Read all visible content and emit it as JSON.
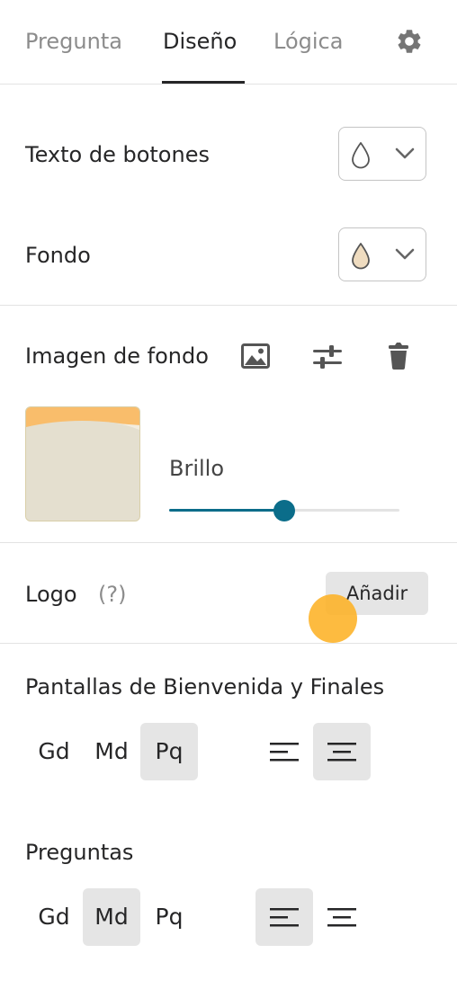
{
  "tabs": [
    {
      "label": "Pregunta",
      "active": false
    },
    {
      "label": "Diseño",
      "active": true
    },
    {
      "label": "Lógica",
      "active": false
    }
  ],
  "settings_icon": "gear-icon",
  "button_text": {
    "label": "Texto de botones",
    "color": "#ffffff"
  },
  "background": {
    "label": "Fondo",
    "color": "#efdcc0"
  },
  "background_image": {
    "label": "Imagen de fondo",
    "icons": [
      "image-icon",
      "sliders-icon",
      "trash-icon"
    ],
    "brightness_label": "Brillo",
    "brightness_fraction": 0.5
  },
  "logo": {
    "label": "Logo",
    "help": "(?)",
    "add_label": "Añadir"
  },
  "welcome_screens": {
    "label": "Pantallas de Bienvenida y Finales",
    "sizes": [
      "Gd",
      "Md",
      "Pq"
    ],
    "selected_size": "Pq",
    "alignment": "center"
  },
  "questions": {
    "label": "Preguntas",
    "sizes": [
      "Gd",
      "Md",
      "Pq"
    ],
    "selected_size": "Md",
    "alignment": "left"
  },
  "colors": {
    "accent": "#0b6d8a",
    "cursor": "#fdb226",
    "thumb_top": "#f9bd6b",
    "thumb_body": "#e4dfcf"
  }
}
